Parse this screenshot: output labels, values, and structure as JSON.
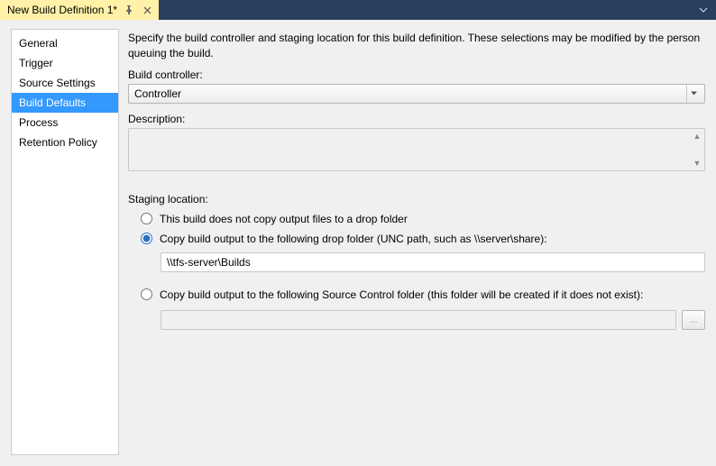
{
  "titlebar": {
    "tab_label": "New Build Definition 1*"
  },
  "sidebar": {
    "items": [
      {
        "label": "General"
      },
      {
        "label": "Trigger"
      },
      {
        "label": "Source Settings"
      },
      {
        "label": "Build Defaults"
      },
      {
        "label": "Process"
      },
      {
        "label": "Retention Policy"
      }
    ],
    "selected_index": 3
  },
  "main": {
    "intro": "Specify the build controller and staging location for this build definition. These selections may be modified by the person queuing the build.",
    "controller_label": "Build controller:",
    "controller_value": "Controller",
    "description_label": "Description:",
    "description_value": "",
    "staging_label": "Staging location:",
    "radios": {
      "no_copy": "This build does not copy output files to a drop folder",
      "unc": "Copy build output to the following drop folder (UNC path, such as \\\\server\\share):",
      "scc": "Copy build output to the following Source Control folder (this folder will be created if it does not exist):"
    },
    "unc_path_value": "\\\\tfs-server\\Builds",
    "scc_path_value": "",
    "browse_label": "..."
  }
}
